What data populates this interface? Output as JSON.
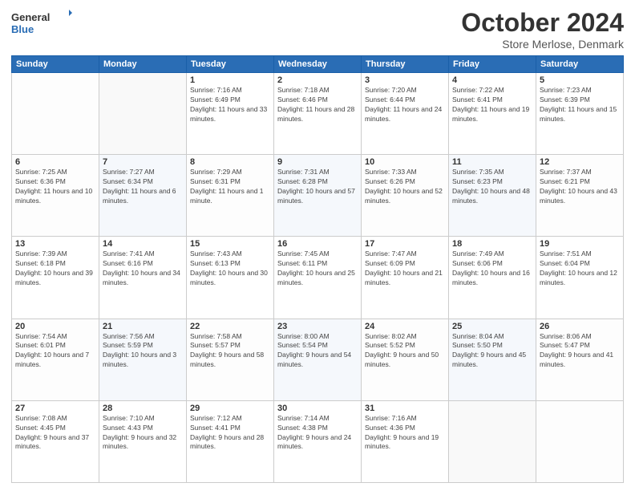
{
  "header": {
    "logo_line1": "General",
    "logo_line2": "Blue",
    "month_title": "October 2024",
    "location": "Store Merlose, Denmark"
  },
  "weekdays": [
    "Sunday",
    "Monday",
    "Tuesday",
    "Wednesday",
    "Thursday",
    "Friday",
    "Saturday"
  ],
  "weeks": [
    [
      {
        "day": "",
        "info": ""
      },
      {
        "day": "",
        "info": ""
      },
      {
        "day": "1",
        "sunrise": "Sunrise: 7:16 AM",
        "sunset": "Sunset: 6:49 PM",
        "daylight": "Daylight: 11 hours and 33 minutes."
      },
      {
        "day": "2",
        "sunrise": "Sunrise: 7:18 AM",
        "sunset": "Sunset: 6:46 PM",
        "daylight": "Daylight: 11 hours and 28 minutes."
      },
      {
        "day": "3",
        "sunrise": "Sunrise: 7:20 AM",
        "sunset": "Sunset: 6:44 PM",
        "daylight": "Daylight: 11 hours and 24 minutes."
      },
      {
        "day": "4",
        "sunrise": "Sunrise: 7:22 AM",
        "sunset": "Sunset: 6:41 PM",
        "daylight": "Daylight: 11 hours and 19 minutes."
      },
      {
        "day": "5",
        "sunrise": "Sunrise: 7:23 AM",
        "sunset": "Sunset: 6:39 PM",
        "daylight": "Daylight: 11 hours and 15 minutes."
      }
    ],
    [
      {
        "day": "6",
        "sunrise": "Sunrise: 7:25 AM",
        "sunset": "Sunset: 6:36 PM",
        "daylight": "Daylight: 11 hours and 10 minutes."
      },
      {
        "day": "7",
        "sunrise": "Sunrise: 7:27 AM",
        "sunset": "Sunset: 6:34 PM",
        "daylight": "Daylight: 11 hours and 6 minutes."
      },
      {
        "day": "8",
        "sunrise": "Sunrise: 7:29 AM",
        "sunset": "Sunset: 6:31 PM",
        "daylight": "Daylight: 11 hours and 1 minute."
      },
      {
        "day": "9",
        "sunrise": "Sunrise: 7:31 AM",
        "sunset": "Sunset: 6:28 PM",
        "daylight": "Daylight: 10 hours and 57 minutes."
      },
      {
        "day": "10",
        "sunrise": "Sunrise: 7:33 AM",
        "sunset": "Sunset: 6:26 PM",
        "daylight": "Daylight: 10 hours and 52 minutes."
      },
      {
        "day": "11",
        "sunrise": "Sunrise: 7:35 AM",
        "sunset": "Sunset: 6:23 PM",
        "daylight": "Daylight: 10 hours and 48 minutes."
      },
      {
        "day": "12",
        "sunrise": "Sunrise: 7:37 AM",
        "sunset": "Sunset: 6:21 PM",
        "daylight": "Daylight: 10 hours and 43 minutes."
      }
    ],
    [
      {
        "day": "13",
        "sunrise": "Sunrise: 7:39 AM",
        "sunset": "Sunset: 6:18 PM",
        "daylight": "Daylight: 10 hours and 39 minutes."
      },
      {
        "day": "14",
        "sunrise": "Sunrise: 7:41 AM",
        "sunset": "Sunset: 6:16 PM",
        "daylight": "Daylight: 10 hours and 34 minutes."
      },
      {
        "day": "15",
        "sunrise": "Sunrise: 7:43 AM",
        "sunset": "Sunset: 6:13 PM",
        "daylight": "Daylight: 10 hours and 30 minutes."
      },
      {
        "day": "16",
        "sunrise": "Sunrise: 7:45 AM",
        "sunset": "Sunset: 6:11 PM",
        "daylight": "Daylight: 10 hours and 25 minutes."
      },
      {
        "day": "17",
        "sunrise": "Sunrise: 7:47 AM",
        "sunset": "Sunset: 6:09 PM",
        "daylight": "Daylight: 10 hours and 21 minutes."
      },
      {
        "day": "18",
        "sunrise": "Sunrise: 7:49 AM",
        "sunset": "Sunset: 6:06 PM",
        "daylight": "Daylight: 10 hours and 16 minutes."
      },
      {
        "day": "19",
        "sunrise": "Sunrise: 7:51 AM",
        "sunset": "Sunset: 6:04 PM",
        "daylight": "Daylight: 10 hours and 12 minutes."
      }
    ],
    [
      {
        "day": "20",
        "sunrise": "Sunrise: 7:54 AM",
        "sunset": "Sunset: 6:01 PM",
        "daylight": "Daylight: 10 hours and 7 minutes."
      },
      {
        "day": "21",
        "sunrise": "Sunrise: 7:56 AM",
        "sunset": "Sunset: 5:59 PM",
        "daylight": "Daylight: 10 hours and 3 minutes."
      },
      {
        "day": "22",
        "sunrise": "Sunrise: 7:58 AM",
        "sunset": "Sunset: 5:57 PM",
        "daylight": "Daylight: 9 hours and 58 minutes."
      },
      {
        "day": "23",
        "sunrise": "Sunrise: 8:00 AM",
        "sunset": "Sunset: 5:54 PM",
        "daylight": "Daylight: 9 hours and 54 minutes."
      },
      {
        "day": "24",
        "sunrise": "Sunrise: 8:02 AM",
        "sunset": "Sunset: 5:52 PM",
        "daylight": "Daylight: 9 hours and 50 minutes."
      },
      {
        "day": "25",
        "sunrise": "Sunrise: 8:04 AM",
        "sunset": "Sunset: 5:50 PM",
        "daylight": "Daylight: 9 hours and 45 minutes."
      },
      {
        "day": "26",
        "sunrise": "Sunrise: 8:06 AM",
        "sunset": "Sunset: 5:47 PM",
        "daylight": "Daylight: 9 hours and 41 minutes."
      }
    ],
    [
      {
        "day": "27",
        "sunrise": "Sunrise: 7:08 AM",
        "sunset": "Sunset: 4:45 PM",
        "daylight": "Daylight: 9 hours and 37 minutes."
      },
      {
        "day": "28",
        "sunrise": "Sunrise: 7:10 AM",
        "sunset": "Sunset: 4:43 PM",
        "daylight": "Daylight: 9 hours and 32 minutes."
      },
      {
        "day": "29",
        "sunrise": "Sunrise: 7:12 AM",
        "sunset": "Sunset: 4:41 PM",
        "daylight": "Daylight: 9 hours and 28 minutes."
      },
      {
        "day": "30",
        "sunrise": "Sunrise: 7:14 AM",
        "sunset": "Sunset: 4:38 PM",
        "daylight": "Daylight: 9 hours and 24 minutes."
      },
      {
        "day": "31",
        "sunrise": "Sunrise: 7:16 AM",
        "sunset": "Sunset: 4:36 PM",
        "daylight": "Daylight: 9 hours and 19 minutes."
      },
      {
        "day": "",
        "info": ""
      },
      {
        "day": "",
        "info": ""
      }
    ]
  ]
}
